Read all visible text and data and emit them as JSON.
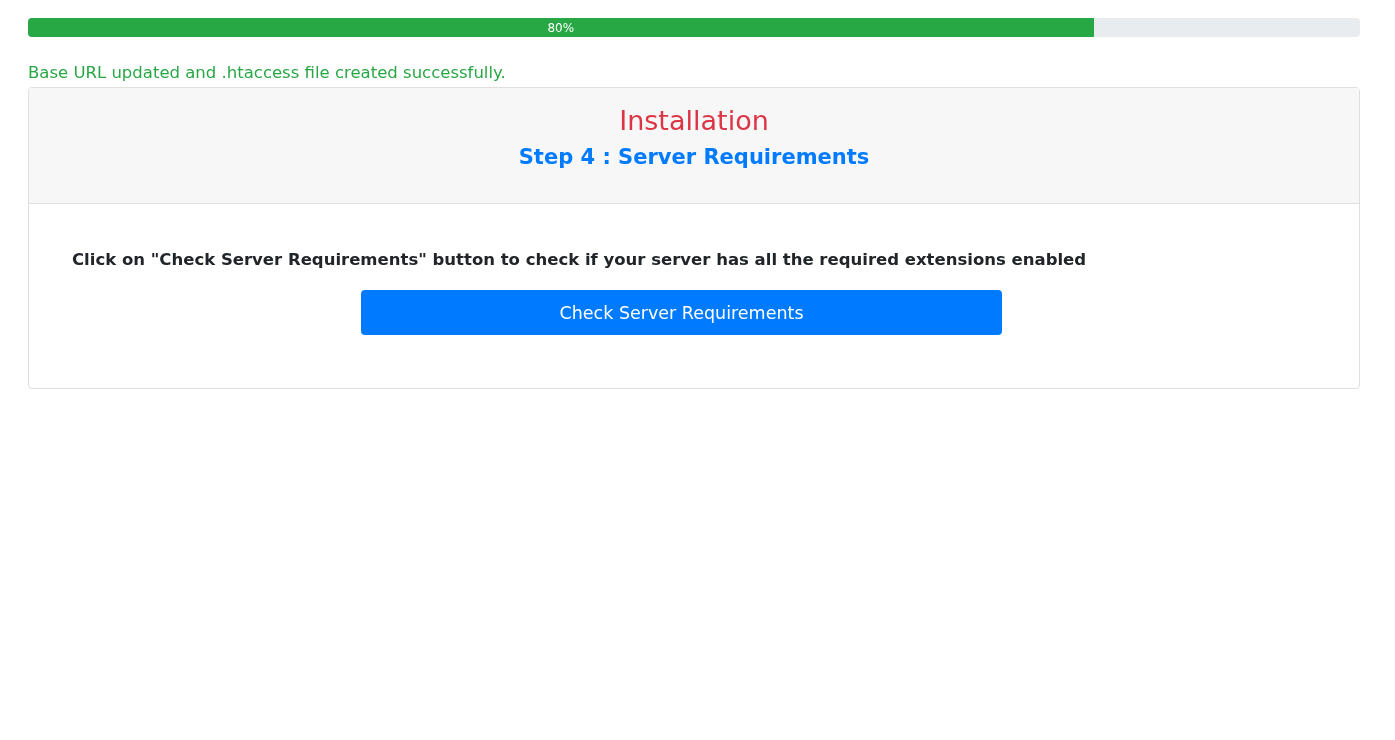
{
  "progress": {
    "level": 0.8,
    "label": "80%"
  },
  "message": "Base URL updated and .htaccess file created successfully.",
  "card": {
    "title": "Installation",
    "subtitle": "Step 4 : Server Requirements",
    "instruction": "Click on \"Check Server Requirements\" button to check if your server has all the required extensions enabled",
    "button": "Check Server Requirements"
  }
}
